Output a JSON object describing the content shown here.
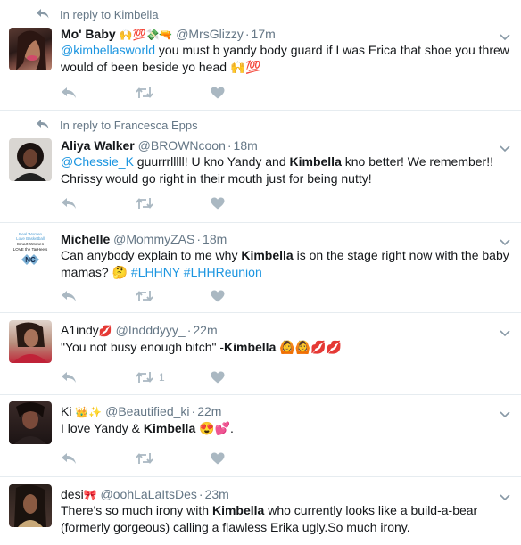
{
  "icons": {
    "reply": "reply-icon",
    "retweet": "retweet-icon",
    "like": "heart-icon",
    "caret": "chevron-down-icon"
  },
  "colors": {
    "link": "#1b95e0",
    "secondary": "#657786",
    "action": "#aab8c2",
    "divider": "#e6ecf0"
  },
  "tweets": [
    {
      "reply_context": "In reply to Kimbella",
      "name": "Mo' Baby",
      "name_emoji": "🙌💯💸🔫",
      "handle": "@MrsGlizzy",
      "time": "17m",
      "text": {
        "mention": "@kimbellasworld",
        "body": " you must b yandy body guard if I was Erica that shoe you threw would of been beside yo head ",
        "emoji": "🙌💯"
      }
    },
    {
      "reply_context": "In reply to Francesca Epps",
      "name": "Aliya Walker",
      "handle": "@BROWNcoon",
      "time": "18m",
      "text": {
        "mention": "@Chessie_K",
        "part1": " guurrrlllll! U kno Yandy and ",
        "kw": "Kimbella",
        "part2": " kno better! We remember!! Chrissy would go right in their mouth just for being nutty!"
      }
    },
    {
      "name": "Michelle",
      "handle": "@MommyZAS",
      "time": "18m",
      "avatar_text": [
        "Real Women",
        "Love Basketball",
        "Smart Women",
        "LOVE the TarHeels"
      ],
      "text": {
        "part1": "Can anybody explain to me why ",
        "kw": "Kimbella",
        "part2": " is on the stage right now with the baby mamas? ",
        "emoji": "🤔",
        "tags": [
          "#LHHNY",
          "#LHHReunion"
        ]
      }
    },
    {
      "name": "A1indy",
      "name_emoji": "💋",
      "handle": "@Indddyyy_",
      "time": "22m",
      "retweets": "1",
      "text": {
        "part1": "\"You not busy enough bitch\" -",
        "kw": "Kimbella",
        "emoji": " 🙆🙆💋💋"
      }
    },
    {
      "name": "Ki",
      "name_emoji": "👑✨",
      "handle": "@Beautified_ki",
      "time": "22m",
      "text": {
        "part1": "I love Yandy & ",
        "kw": "Kimbella",
        "emoji": " 😍💕",
        "part2": "."
      }
    },
    {
      "name": "desi",
      "name_emoji": "🎀",
      "handle": "@oohLaLaItsDes",
      "time": "23m",
      "text": {
        "part1": "There's so much irony with ",
        "kw": "Kimbella",
        "part2": " who currently looks like a build-a-bear (formerly gorgeous) calling a flawless Erika ugly.So much irony."
      }
    }
  ]
}
